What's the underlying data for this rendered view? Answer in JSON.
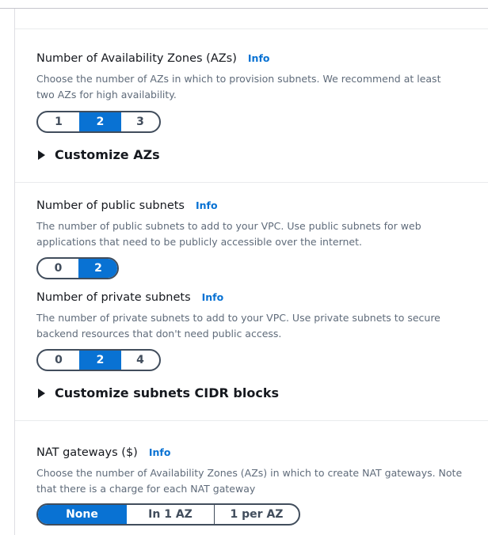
{
  "az": {
    "label": "Number of Availability Zones (AZs)",
    "info": "Info",
    "description": "Choose the number of AZs in which to provision subnets. We recommend at least two AZs for high availability.",
    "options": [
      "1",
      "2",
      "3"
    ],
    "selected": "2",
    "customize": "Customize AZs"
  },
  "public_subnets": {
    "label": "Number of public subnets",
    "info": "Info",
    "description": "The number of public subnets to add to your VPC. Use public subnets for web applications that need to be publicly accessible over the internet.",
    "options": [
      "0",
      "2"
    ],
    "selected": "2"
  },
  "private_subnets": {
    "label": "Number of private subnets",
    "info": "Info",
    "description": "The number of private subnets to add to your VPC. Use private subnets to secure backend resources that don't need public access.",
    "options": [
      "0",
      "2",
      "4"
    ],
    "selected": "2",
    "customize": "Customize subnets CIDR blocks"
  },
  "nat": {
    "label": "NAT gateways ($)",
    "info": "Info",
    "description": "Choose the number of Availability Zones (AZs) in which to create NAT gateways. Note that there is a charge for each NAT gateway",
    "options": [
      "None",
      "In 1 AZ",
      "1 per AZ"
    ],
    "selected": "None"
  }
}
